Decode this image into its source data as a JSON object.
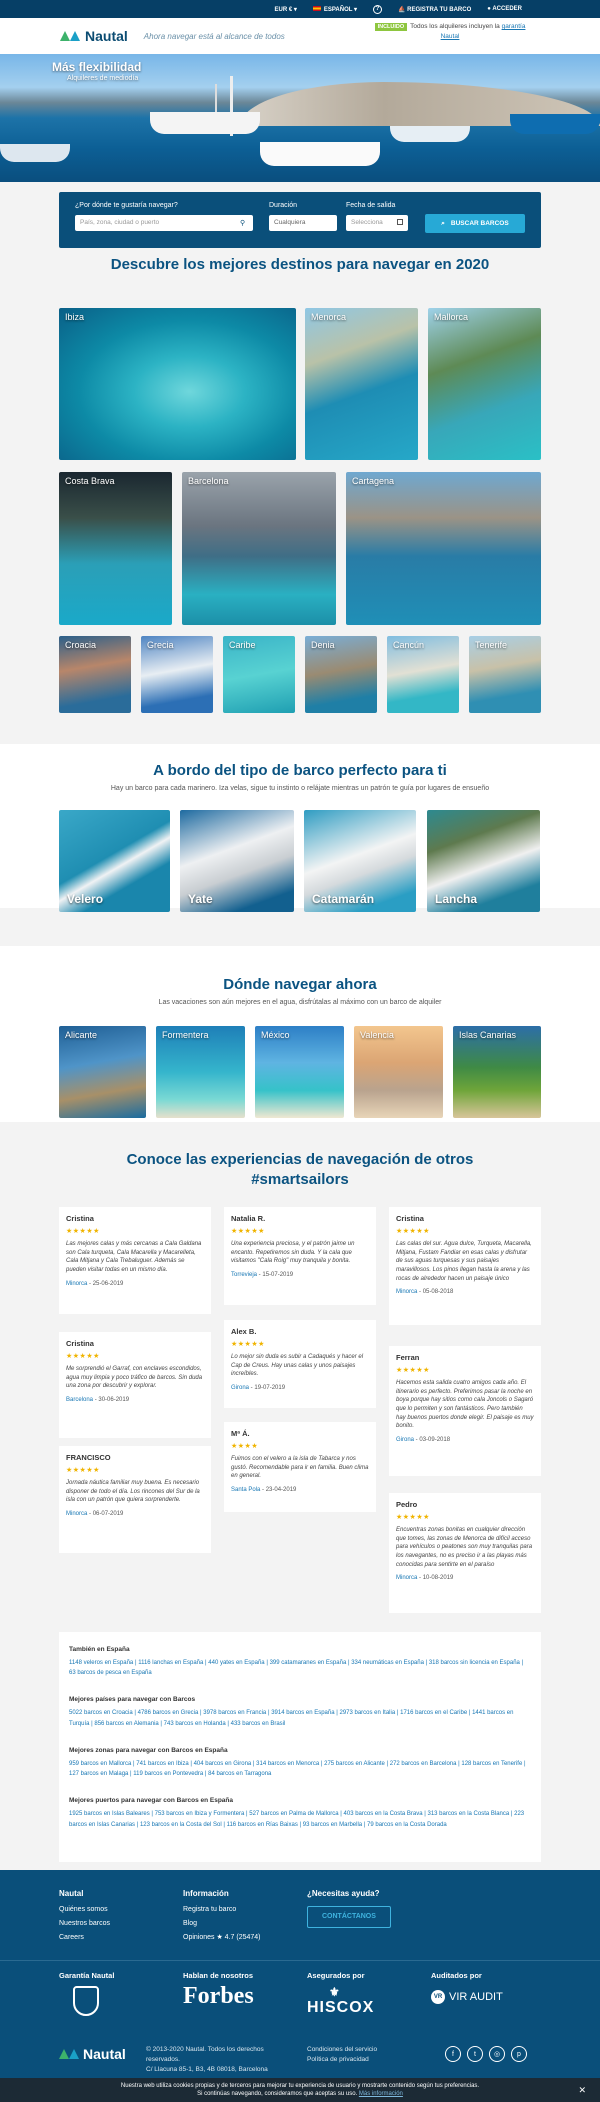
{
  "topbar": {
    "currency": "EUR € ▾",
    "language": "ESPAÑOL ▾",
    "help": "?",
    "register": "REGISTRA TU BARCO",
    "login": "ACCEDER"
  },
  "header": {
    "logo": "Nautal",
    "tagline": "Ahora navegar está al alcance de todos",
    "promo_badge": "INCLUIDO",
    "promo_text": "Todos los alquileres incluyen la",
    "promo_link": "garantía Nautal"
  },
  "hero": {
    "title": "Más flexibilidad",
    "subtitle": "Alquileres de mediodía"
  },
  "search": {
    "where_label": "¿Por dónde te gustaría navegar?",
    "where_placeholder": "País, zona, ciudad o puerto",
    "duration_label": "Duración",
    "duration_value": "Cualquiera",
    "date_label": "Fecha de salida",
    "date_value": "Selecciona",
    "button": "BUSCAR BARCOS"
  },
  "destinations": {
    "title": "Descubre los mejores destinos para navegar en 2020",
    "items": [
      "Ibiza",
      "Menorca",
      "Mallorca",
      "Costa Brava",
      "Barcelona",
      "Cartagena",
      "Croacia",
      "Grecia",
      "Caribe",
      "Denia",
      "Cancún",
      "Tenerife"
    ]
  },
  "types": {
    "title": "A bordo del tipo de barco perfecto para ti",
    "subtitle": "Hay un barco para cada marinero. Iza velas, sigue tu instinto o relájate mientras un patrón te guía por lugares de ensueño",
    "items": [
      "Velero",
      "Yate",
      "Catamarán",
      "Lancha"
    ]
  },
  "where": {
    "title": "Dónde navegar ahora",
    "subtitle": "Las vacaciones son aún mejores en el agua, disfrútalas al máximo con un barco de alquiler",
    "items": [
      "Alicante",
      "Formentera",
      "México",
      "Valencia",
      "Islas Canarias"
    ]
  },
  "reviews": {
    "title": "Conoce las experiencias de navegación de otros #smartsailors",
    "items": [
      {
        "name": "Cristina",
        "stars": "★★★★★",
        "text": "Las mejores calas y más cercanas a Cala Galdana son Cala turqueta, Cala Macarella y Macarelleta, Cala Mitjana y Cala Trebaluguer. Además se pueden visitar todas en un mismo día.",
        "place": "Minorca",
        "date": "25-06-2019"
      },
      {
        "name": "Cristina",
        "stars": "★★★★★",
        "text": "Me sorprendió el Garraf, con enclaves escondidos, agua muy limpia y poco tráfico de barcos. Sin duda una zona por descubrir y explorar.",
        "place": "Barcelona",
        "date": "30-06-2019"
      },
      {
        "name": "FRANCISCO",
        "stars": "★★★★★",
        "text": "Jornada náutica familiar muy buena. Es necesario disponer de todo el día. Los rincones del Sur de la isla con un patrón que quiera sorprenderte.",
        "place": "Minorca",
        "date": "06-07-2019"
      },
      {
        "name": "Natalia R.",
        "stars": "★★★★★",
        "text": "Una experiencia preciosa, y el patrón jaime un encanto. Repetiremos sin duda. Y la cala que visitamos \"Cala Roig\" muy tranquila y bonita.",
        "place": "Torrevieja",
        "date": "15-07-2019"
      },
      {
        "name": "Alex B.",
        "stars": "★★★★★",
        "text": "Lo mejor sin duda es subir a Cadaqués y hacer el Cap de Creus. Hay unas calas y unos paisajes increíbles.",
        "place": "Girona",
        "date": "19-07-2019"
      },
      {
        "name": "Mª Á.",
        "stars": "★★★★",
        "text": "Fuimos con el velero a la isla de Tabarca y nos gustó. Recomendable para ir en familia. Buen clima en general.",
        "place": "Santa Pola",
        "date": "23-04-2019"
      },
      {
        "name": "Cristina",
        "stars": "★★★★★",
        "text": "Las calas del sur. Agua dulce, Turqueta, Macarella, Mitjana, Fustam Fandiar en esas calas y disfrutar de sus aguas turquesas y sus paisajes maravillosos. Los pinos llegan hasta la arena y las rocas de alrededor hacen un paisaje único",
        "place": "Minorca",
        "date": "05-08-2018"
      },
      {
        "name": "Ferran",
        "stars": "★★★★★",
        "text": "Hacemos esta salida cuatro amigos cada año. El itinerario es perfecto. Preferimos pasar la noche en boya porque hay sitios como cala Joncols o Sagaró que lo permiten y son fantásticos. Pero también hay buenos puertos donde elegir. El paisaje es muy bonito.",
        "place": "Girona",
        "date": "03-09-2018"
      },
      {
        "name": "Pedro",
        "stars": "★★★★★",
        "text": "Encuentras zonas bonitas en cualquier dirección que tomes, las zonas de Menorca de difícil acceso para vehículos o peatones son muy tranquilas para los navegantes, no es preciso ir a las playas más conocidas para sentirte en el paraíso",
        "place": "Minorca",
        "date": "10-08-2019"
      }
    ]
  },
  "links": {
    "groups": [
      {
        "title": "También en España",
        "items": [
          "1148 veleros en España",
          "1116 lanchas en España",
          "440 yates en España",
          "399 catamaranes en España",
          "334 neumáticas en España",
          "318 barcos sin licencia en España",
          "63 barcos de pesca en España"
        ]
      },
      {
        "title": "Mejores países para navegar con Barcos",
        "items": [
          "5022 barcos en Croacia",
          "4786 barcos en Grecia",
          "3978 barcos en Francia",
          "3914 barcos en España",
          "2973 barcos en Italia",
          "1716 barcos en el Caribe",
          "1441 barcos en Turquía",
          "856 barcos en Alemania",
          "743 barcos en Holanda",
          "433 barcos en Brasil"
        ]
      },
      {
        "title": "Mejores zonas para navegar con Barcos en España",
        "items": [
          "959 barcos en Mallorca",
          "741 barcos en Ibiza",
          "404 barcos en Girona",
          "314 barcos en Menorca",
          "275 barcos en Alicante",
          "272 barcos en Barcelona",
          "128 barcos en Tenerife",
          "127 barcos en Malaga",
          "119 barcos en Pontevedra",
          "84 barcos en Tarragona"
        ]
      },
      {
        "title": "Mejores puertos para navegar con Barcos en España",
        "items": [
          "1925 barcos en Islas Baleares",
          "753 barcos en Ibiza y Formentera",
          "527 barcos en Palma de Mallorca",
          "403 barcos en la Costa Brava",
          "313 barcos en la Costa Blanca",
          "223 barcos en Islas Canarias",
          "123 barcos en la Costa del Sol",
          "116 barcos en Rías Baixas",
          "93 barcos en Marbella",
          "79 barcos en la Costa Dorada"
        ]
      }
    ]
  },
  "footer": {
    "col1": {
      "title": "Nautal",
      "items": [
        "Quiénes somos",
        "Nuestros barcos",
        "Careers"
      ]
    },
    "col2": {
      "title": "Información",
      "items": [
        "Registra tu barco",
        "Blog",
        "Opiniones ★ 4.7 (25474)"
      ]
    },
    "col3": {
      "title": "¿Necesitas ayuda?",
      "button": "CONTÁCTANOS"
    },
    "badges": {
      "guarantee": "Garantía Nautal",
      "press": "Hablan de nosotros",
      "press_logo": "Forbes",
      "insured": "Asegurados por",
      "insured_logo": "HISCOX",
      "audited": "Auditados por",
      "audited_logo": "VIR AUDIT"
    },
    "copyright": "© 2013-2020 Nautal. Todos los derechos reservados.",
    "address": "C/ Llacuna 85-1, B3, 4B 08018, Barcelona",
    "conditions": "Condiciones del servicio",
    "privacy": "Política de privacidad"
  },
  "cookie": {
    "text1": "Nuestra web utiliza cookies propias y de terceros para mejorar tu experiencia de usuario y mostrarte contenido según tus preferencias.",
    "text2": "Si continúas navegando, consideramos que aceptas su uso.",
    "link": "Más información",
    "close": "✕"
  }
}
